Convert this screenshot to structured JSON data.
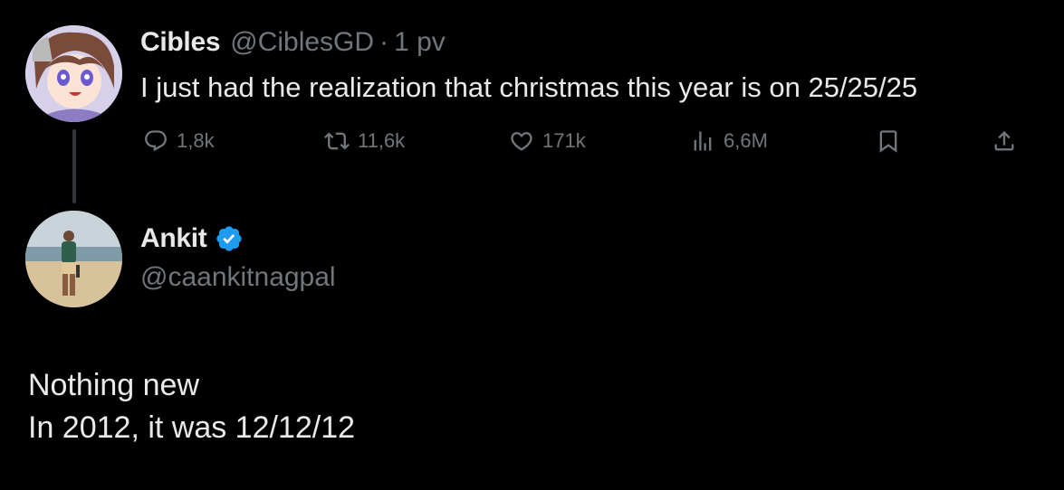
{
  "tweet1": {
    "display_name": "Cibles",
    "handle": "@CiblesGD",
    "separator": "·",
    "time": "1 pv",
    "text": "I just had the realization that christmas this year is on 25/25/25",
    "avatar_icon": "anime-girl-avatar",
    "actions": {
      "replies": "1,8k",
      "retweets": "11,6k",
      "likes": "171k",
      "views": "6,6M"
    }
  },
  "tweet2": {
    "display_name": "Ankit",
    "handle": "@caankitnagpal",
    "verified": true,
    "avatar_icon": "beach-person-avatar",
    "text_lines": [
      "Nothing new",
      "In 2012, it was 12/12/12"
    ]
  },
  "colors": {
    "background": "#000000",
    "text": "#e7e9ea",
    "secondary": "#71767b",
    "verified": "#1d9bf0"
  }
}
